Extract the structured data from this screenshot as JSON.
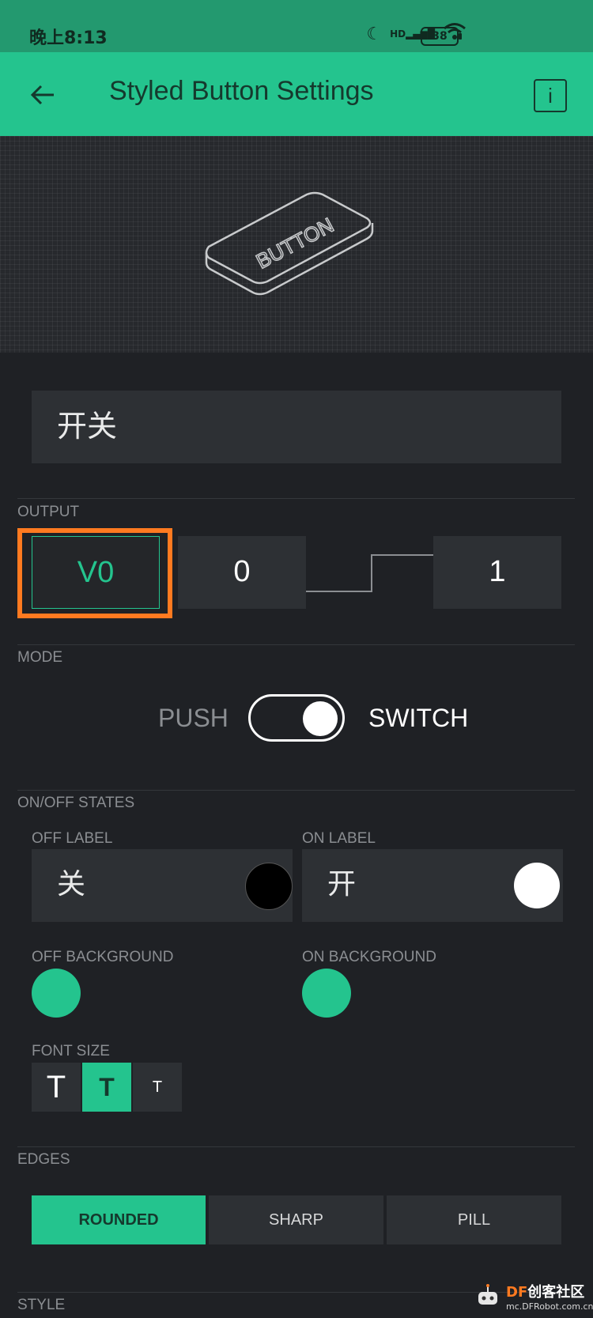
{
  "status": {
    "time": "晚上8:13",
    "battery": "38",
    "network": "HD"
  },
  "appbar": {
    "title": "Styled Button Settings",
    "info": "i"
  },
  "preview": {
    "button_text": "BUTTON"
  },
  "name_field": {
    "value": "开关"
  },
  "output": {
    "label": "OUTPUT",
    "pin": "V0",
    "low": "0",
    "high": "1"
  },
  "mode": {
    "label": "MODE",
    "push": "PUSH",
    "switch": "SWITCH",
    "selected": "SWITCH"
  },
  "states": {
    "label": "ON/OFF STATES",
    "off_label_title": "OFF LABEL",
    "off_label_value": "关",
    "off_color": "#000000",
    "on_label_title": "ON LABEL",
    "on_label_value": "开",
    "on_color": "#ffffff",
    "off_bg_title": "OFF BACKGROUND",
    "off_bg_color": "#24c48e",
    "on_bg_title": "ON BACKGROUND",
    "on_bg_color": "#24c48e"
  },
  "font_size": {
    "label": "FONT SIZE",
    "options": [
      "T",
      "T",
      "T"
    ],
    "selected_index": 1
  },
  "edges": {
    "label": "EDGES",
    "options": [
      "ROUNDED",
      "SHARP",
      "PILL"
    ],
    "selected": "ROUNDED"
  },
  "style": {
    "label": "STYLE"
  },
  "watermark": {
    "brand_df": "DF",
    "brand_cn": "创客社区",
    "url": "mc.DFRobot.com.cn"
  },
  "colors": {
    "accent": "#24c48e",
    "status_bar": "#23996f",
    "background": "#1f2125",
    "field": "#2d3034",
    "highlight": "#ff7a20"
  }
}
